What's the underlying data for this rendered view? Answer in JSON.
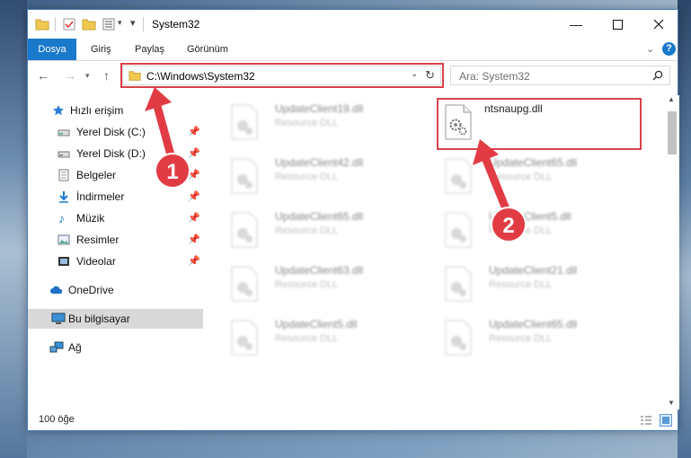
{
  "window": {
    "title": "System32"
  },
  "ribbon": {
    "tabs": [
      {
        "label": "Dosya"
      },
      {
        "label": "Giriş"
      },
      {
        "label": "Paylaş"
      },
      {
        "label": "Görünüm"
      }
    ]
  },
  "address": {
    "path": "C:\\Windows\\System32"
  },
  "search": {
    "placeholder": "Ara: System32"
  },
  "sidebar": {
    "items": [
      {
        "label": "Hızlı erişim",
        "icon": "star-icon"
      },
      {
        "label": "Yerel Disk (C:)",
        "icon": "drive-icon"
      },
      {
        "label": "Yerel Disk (D:)",
        "icon": "drive-icon"
      },
      {
        "label": "Belgeler",
        "icon": "document-icon"
      },
      {
        "label": "İndirmeler",
        "icon": "download-icon"
      },
      {
        "label": "Müzik",
        "icon": "music-icon"
      },
      {
        "label": "Resimler",
        "icon": "picture-icon"
      },
      {
        "label": "Videolar",
        "icon": "video-icon"
      },
      {
        "label": "OneDrive",
        "icon": "cloud-icon"
      },
      {
        "label": "Bu bilgisayar",
        "icon": "computer-icon"
      },
      {
        "label": "Ağ",
        "icon": "network-icon"
      }
    ]
  },
  "files": [
    {
      "name": "UpdateClient19.dll",
      "type": "Resource DLL"
    },
    {
      "name": "ntsnaupg.dll",
      "type": ""
    },
    {
      "name": "UpdateClient42.dll",
      "type": "Resource DLL"
    },
    {
      "name": "UpdateClient65.dll",
      "type": "Resource DLL"
    },
    {
      "name": "UpdateClient65.dll",
      "type": "Resource DLL"
    },
    {
      "name": "UpdateClient5.dll",
      "type": "Resource DLL"
    },
    {
      "name": "UpdateClient63.dll",
      "type": "Resource DLL"
    },
    {
      "name": "UpdateClient21.dll",
      "type": "Resource DLL"
    },
    {
      "name": "UpdateClient5.dll",
      "type": "Resource DLL"
    },
    {
      "name": "UpdateClient65.dll",
      "type": "Resource DLL"
    }
  ],
  "status": {
    "item_count": "100 öğe"
  },
  "annotations": {
    "step1": "1",
    "step2": "2",
    "color": "#e13c44"
  }
}
